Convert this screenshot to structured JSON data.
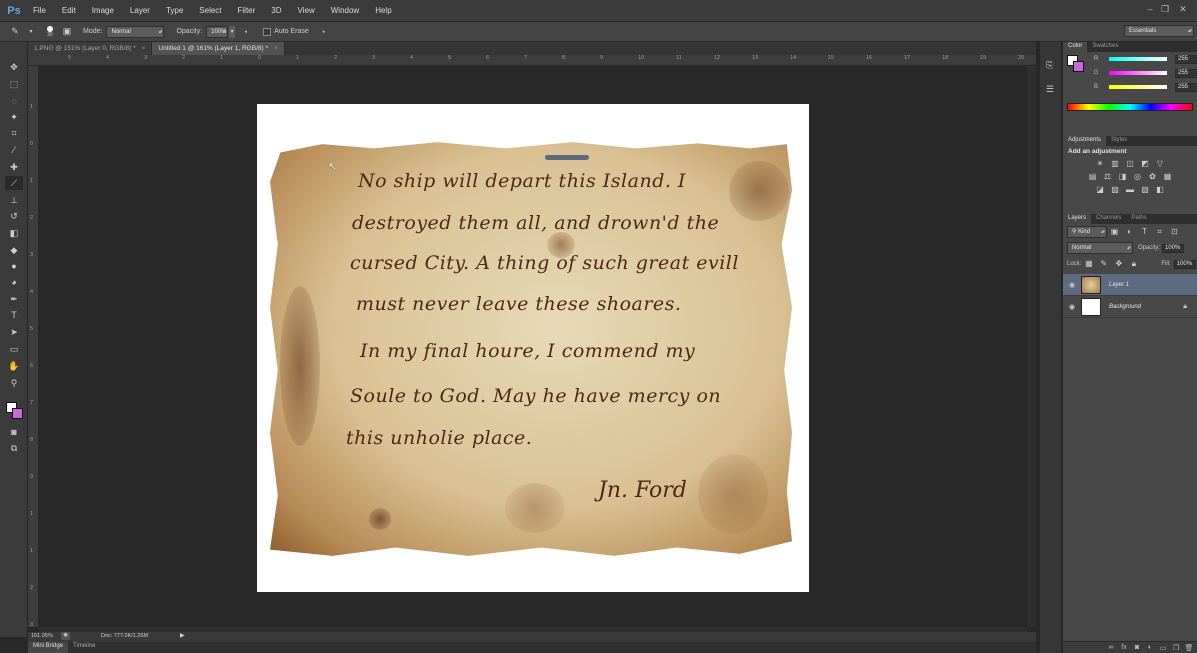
{
  "app": {
    "logo": "Ps",
    "win_controls": [
      "–",
      "❐",
      "✕"
    ]
  },
  "menu": [
    "File",
    "Edit",
    "Image",
    "Layer",
    "Type",
    "Select",
    "Filter",
    "3D",
    "View",
    "Window",
    "Help"
  ],
  "options_bar": {
    "brush_size": "30",
    "mode_label": "Mode:",
    "mode_value": "Normal",
    "opacity_label": "Opacity:",
    "opacity_value": "100%",
    "auto_erase_label": "Auto Erase",
    "workspace": "Essentials"
  },
  "tabs": [
    {
      "label": "1.PNG @ 151% (Layer 0, RGB/8) *",
      "active": false
    },
    {
      "label": "Untitled 1 @ 161% (Layer 1, RGB/8) *",
      "active": true
    }
  ],
  "ruler_h": [
    "5",
    "4",
    "3",
    "2",
    "1",
    "0",
    "1",
    "2",
    "3",
    "4",
    "5",
    "6",
    "7",
    "8",
    "9",
    "10",
    "11",
    "12",
    "13",
    "14",
    "15",
    "16",
    "17",
    "18",
    "19",
    "20"
  ],
  "ruler_v": [
    "1",
    "0",
    "1",
    "2",
    "3",
    "4",
    "5",
    "6",
    "7",
    "8",
    "9",
    "1",
    "1",
    "2",
    "3"
  ],
  "document": {
    "lines": [
      "No ship will depart this Island. I",
      "destroyed them all, and drown'd the",
      "cursed City. A thing of such great evill",
      "must never leave these shoares.",
      "In my final houre, I commend my",
      "Soule to God. May he have mercy on",
      "this unholie place."
    ],
    "signature": "Jn. Ford"
  },
  "status": {
    "zoom": "161.05%",
    "doc": "Doc: 777.0K/1.26M"
  },
  "bottom_tabs": [
    "Mini Bridge",
    "Timeline"
  ],
  "color_panel": {
    "tabs": [
      "Color",
      "Swatches"
    ],
    "channels": [
      {
        "label": "R",
        "value": "255"
      },
      {
        "label": "G",
        "value": "255"
      },
      {
        "label": "B",
        "value": "255"
      }
    ]
  },
  "adjustments_panel": {
    "tabs": [
      "Adjustments",
      "Styles"
    ],
    "title": "Add an adjustment"
  },
  "layers_panel": {
    "tabs": [
      "Layers",
      "Channels",
      "Paths"
    ],
    "kind": "Kind",
    "blend_mode": "Normal",
    "opacity_label": "Opacity:",
    "opacity_value": "100%",
    "lock_label": "Lock:",
    "fill_label": "Fill:",
    "fill_value": "100%",
    "layers": [
      {
        "name": "Layer 1",
        "selected": true
      },
      {
        "name": "Background",
        "selected": false
      }
    ]
  }
}
